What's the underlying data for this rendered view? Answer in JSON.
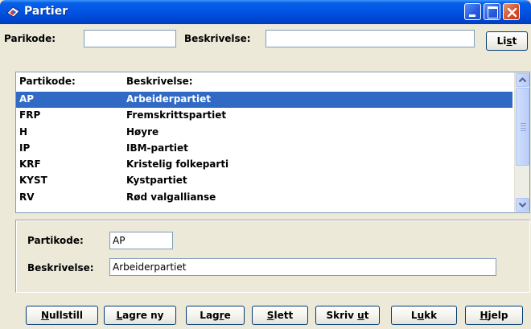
{
  "window": {
    "title": "Partier"
  },
  "search": {
    "partikode_label": "Parikode:",
    "partikode_value": "",
    "beskrivelse_label": "Beskrivelse:",
    "beskrivelse_value": "",
    "list_button_pre": "Li",
    "list_button_key": "s",
    "list_button_post": "t"
  },
  "list": {
    "headers": {
      "code": "Partikode:",
      "description": "Beskrivelse:"
    },
    "rows": [
      {
        "code": "AP",
        "description": "Arbeiderpartiet",
        "selected": true
      },
      {
        "code": "FRP",
        "description": "Fremskrittspartiet",
        "selected": false
      },
      {
        "code": "H",
        "description": "Høyre",
        "selected": false
      },
      {
        "code": "IP",
        "description": "IBM-partiet",
        "selected": false
      },
      {
        "code": "KRF",
        "description": "Kristelig folkeparti",
        "selected": false
      },
      {
        "code": "KYST",
        "description": "Kystpartiet",
        "selected": false
      },
      {
        "code": "RV",
        "description": "Rød valgallianse",
        "selected": false
      }
    ]
  },
  "detail": {
    "code_label": "Partikode:",
    "code_value": "AP",
    "description_label": "Beskrivelse:",
    "description_value": "Arbeiderpartiet"
  },
  "buttons": {
    "reset": {
      "key": "N",
      "rest": "ullstill"
    },
    "save_new": {
      "key": "L",
      "rest": "agre ny"
    },
    "save": {
      "pre": "Lag",
      "key": "r",
      "post": "e"
    },
    "delete": {
      "key": "S",
      "rest": "lett"
    },
    "print": {
      "pre": "Skriv ",
      "key": "u",
      "post": "t"
    },
    "close": {
      "pre": "L",
      "key": "u",
      "post": "kk"
    },
    "help": {
      "key": "H",
      "rest": "jelp"
    }
  },
  "colors": {
    "titlebar": "#0055e5",
    "selection": "#316ac5",
    "window_bg": "#ece9d8",
    "close_button": "#d5532b"
  }
}
